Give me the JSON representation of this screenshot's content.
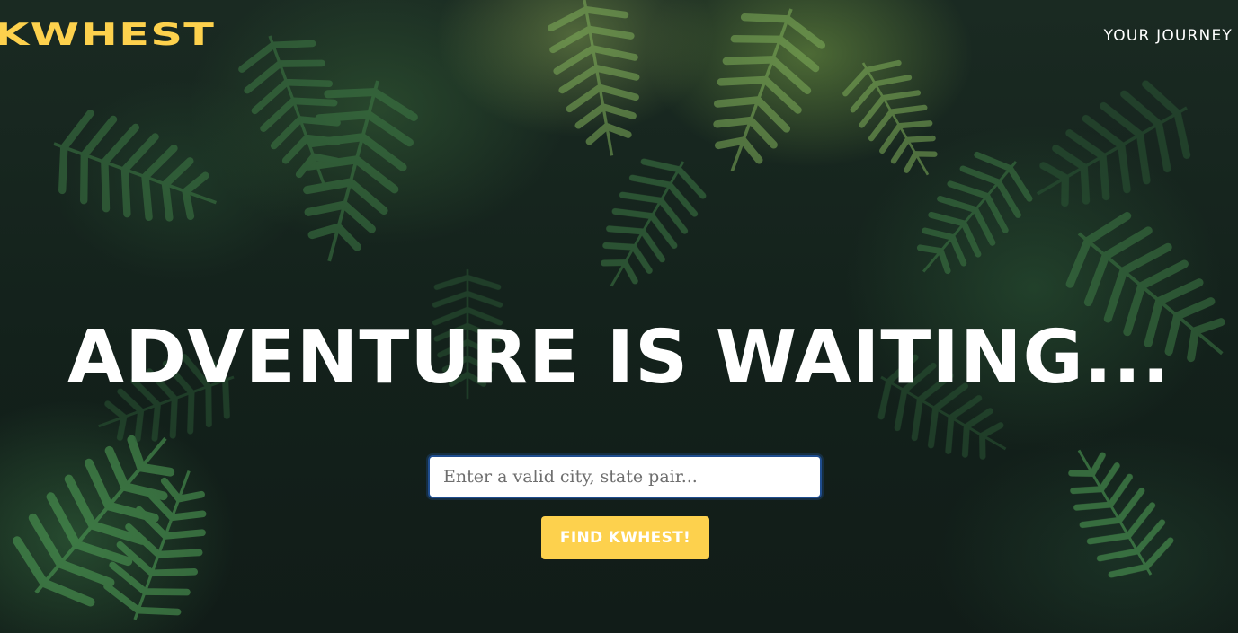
{
  "brand": {
    "logo_text": "KWHEST",
    "accent_color": "#fdd14d"
  },
  "nav": {
    "journey_link": "YOUR JOURNEY"
  },
  "hero": {
    "headline": "ADVENTURE IS WAITING...",
    "background": "dark jungle fern foliage"
  },
  "search": {
    "placeholder": "Enter a valid city, state pair...",
    "value": "",
    "button_label": "FIND KWHEST!"
  }
}
